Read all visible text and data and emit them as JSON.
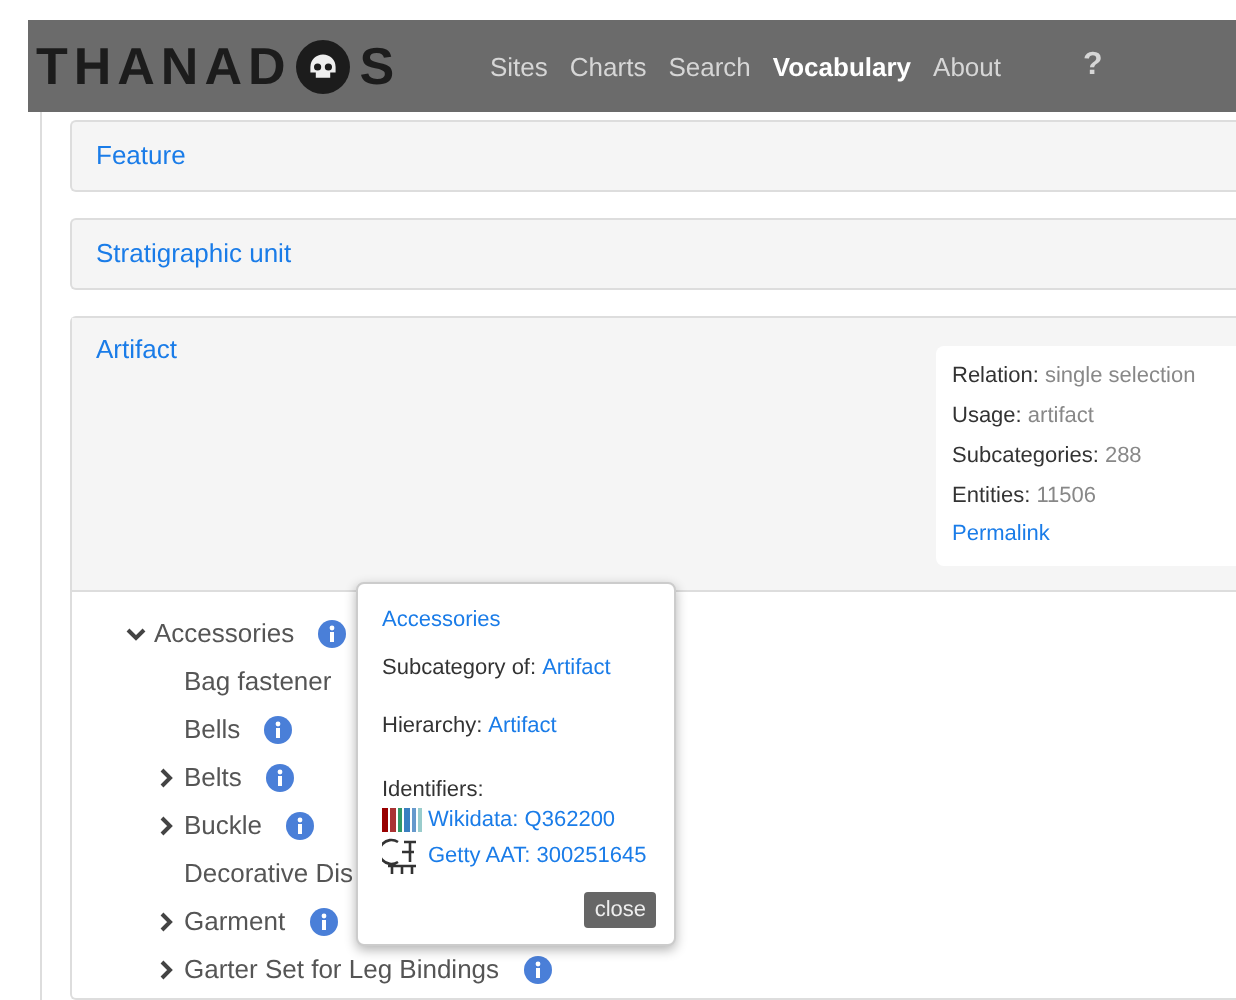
{
  "brand_start": "THANAD",
  "brand_end": "S",
  "nav": [
    {
      "label": "Sites",
      "selected": false
    },
    {
      "label": "Charts",
      "selected": false
    },
    {
      "label": "Search",
      "selected": false
    },
    {
      "label": "Vocabulary",
      "selected": true
    },
    {
      "label": "About",
      "selected": false
    },
    {
      "label": "?",
      "selected": false
    }
  ],
  "sections": [
    {
      "title": "Feature"
    },
    {
      "title": "Stratigraphic unit"
    }
  ],
  "artifact": {
    "title": "Artifact",
    "details": [
      {
        "label": "Relation:",
        "value": "single selection"
      },
      {
        "label": "Usage:",
        "value": "artifact"
      },
      {
        "label": "Subcategories:",
        "value": "288"
      },
      {
        "label": "Entities:",
        "value": "11506"
      }
    ],
    "permalink": "Permalink",
    "tree": [
      {
        "label": "Accessories",
        "kind": "branch",
        "expanded": true,
        "info": true,
        "children": [
          {
            "label": "Bag fastener",
            "kind": "leaf",
            "info": false
          },
          {
            "label": "Bells",
            "kind": "leaf",
            "info": true
          },
          {
            "label": "Belts",
            "kind": "branch",
            "expanded": false,
            "info": true
          },
          {
            "label": "Buckle",
            "kind": "branch",
            "expanded": false,
            "info": true
          },
          {
            "label": "Decorative Dis",
            "kind": "leaf",
            "info": false
          },
          {
            "label": "Garment",
            "kind": "branch",
            "expanded": false,
            "info": true
          },
          {
            "label": "Garter Set for Leg Bindings",
            "kind": "branch",
            "expanded": false,
            "info": true
          }
        ]
      }
    ]
  },
  "popover": {
    "title": "Accessories",
    "subcategory_label": "Subcategory of:",
    "subcategory": "Artifact",
    "hierarchy_label": "Hierarchy:",
    "hierarchy": "Artifact",
    "identifiers_label": "Identifiers:",
    "identifiers": [
      {
        "kind": "wikidata",
        "label": "Wikidata: Q362200"
      },
      {
        "kind": "getty",
        "label": "Getty AAT: 300251645"
      }
    ],
    "close": "close"
  }
}
